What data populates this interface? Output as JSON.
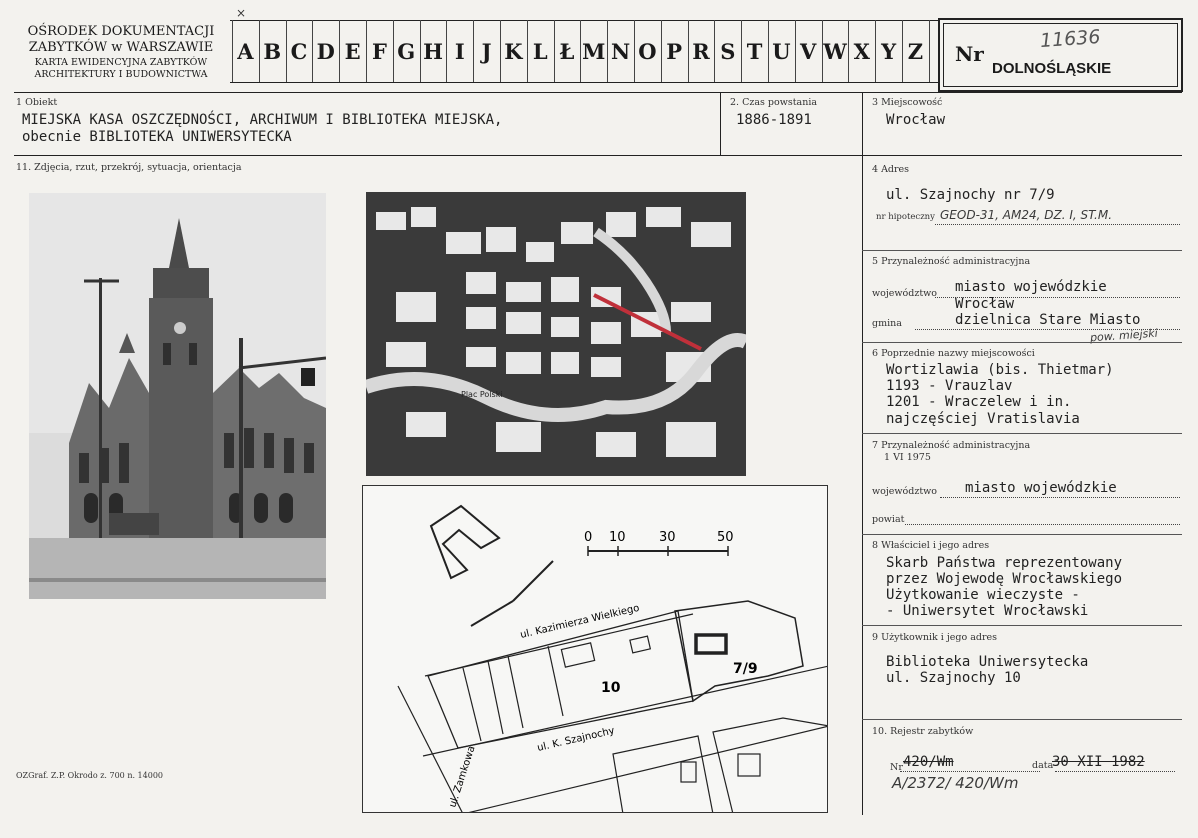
{
  "header": {
    "org_line1": "OŚRODEK DOKUMENTACJI",
    "org_line2": "ZABYTKÓW w WARSZAWIE",
    "org_line3": "KARTA EWIDENCYJNA ZABYTKÓW",
    "org_line4": "ARCHITEKTURY I BUDOWNICTWA",
    "letters": [
      "A",
      "B",
      "C",
      "D",
      "E",
      "F",
      "G",
      "H",
      "I",
      "J",
      "K",
      "L",
      "Ł",
      "M",
      "N",
      "O",
      "P",
      "R",
      "S",
      "T",
      "U",
      "V",
      "W",
      "X",
      "Y",
      "Z"
    ],
    "nr_label": "Nr",
    "nr_handwritten": "11636",
    "voivodeship": "DOLNOŚLĄSKIE"
  },
  "fields": {
    "obiekt": {
      "label": "1 Obiekt",
      "line1": "MIEJSKA KASA OSZCZĘDNOŚCI, ARCHIWUM I BIBLIOTEKA MIEJSKA,",
      "line2": "obecnie BIBLIOTEKA UNIWERSYTECKA"
    },
    "czas": {
      "label": "2. Czas powstania",
      "value": "1886-1891"
    },
    "miejscowosc": {
      "label": "3 Miejscowość",
      "value": "Wrocław"
    },
    "adres": {
      "label": "4 Adres",
      "street": "ul. Szajnochy nr 7/9",
      "hipoteczny_label": "nr hipoteczny",
      "hipoteczny_value": "GEOD-31, AM24, DZ. I, ST.M."
    },
    "przynaleznosc": {
      "label": "5 Przynależność administracyjna",
      "woj_label": "województwo",
      "woj_value": "miasto wojewódzkie",
      "woj_value2": "Wrocław",
      "gmina_label": "gmina",
      "gmina_value": "dzielnica Stare Miasto",
      "gmina_hand": "pow. miejski"
    },
    "nazwy": {
      "label": "6 Poprzednie nazwy miejscowości",
      "lines": [
        "Wortizlawia (bis. Thietmar)",
        "1193 - Vrauzlav",
        "1201 - Wraczelew i in.",
        "najczęściej Vratislavia"
      ]
    },
    "przynaleznosc_1975": {
      "label": "7 Przynależność administracyjna",
      "label2": "1 VI 1975",
      "woj_label": "województwo",
      "woj_value": "miasto wojewódzkie",
      "powiat_label": "powiat"
    },
    "wlasciciel": {
      "label": "8 Właściciel i jego adres",
      "lines": [
        "Skarb Państwa reprezentowany",
        "przez Wojewodę Wrocławskiego",
        "Użytkowanie wieczyste -",
        "- Uniwersytet Wrocławski"
      ]
    },
    "uzytkownik": {
      "label": "9 Użytkownik i jego adres",
      "lines": [
        "Biblioteka Uniwersytecka",
        "ul. Szajnochy 10"
      ]
    },
    "rejestr": {
      "label": "10. Rejestr zabytków",
      "nr_label": "Nr",
      "nr_value": "420/Wm",
      "date_label": "data",
      "date_value": "30 XII 1982",
      "hand": "A/2372/ 420/Wm"
    },
    "zdjecia": {
      "label": "11. Zdjęcia, rzut, przekrój, sytuacja, orientacja"
    }
  },
  "plan": {
    "scale_labels": [
      "0",
      "10",
      "30",
      "50"
    ],
    "street_kazimierza": "ul. Kazimierza Wielkiego",
    "street_szajnochy": "ul. K. Szajnochy",
    "street_zamkowa": "ul. Zamkowa",
    "lot_7_9": "7/9",
    "lot_10": "10"
  },
  "map": {
    "place_label": "Plac Polski"
  },
  "footer": {
    "print_info": "OZGraf. Z.P. Okrodo z. 700 n. 14000"
  }
}
